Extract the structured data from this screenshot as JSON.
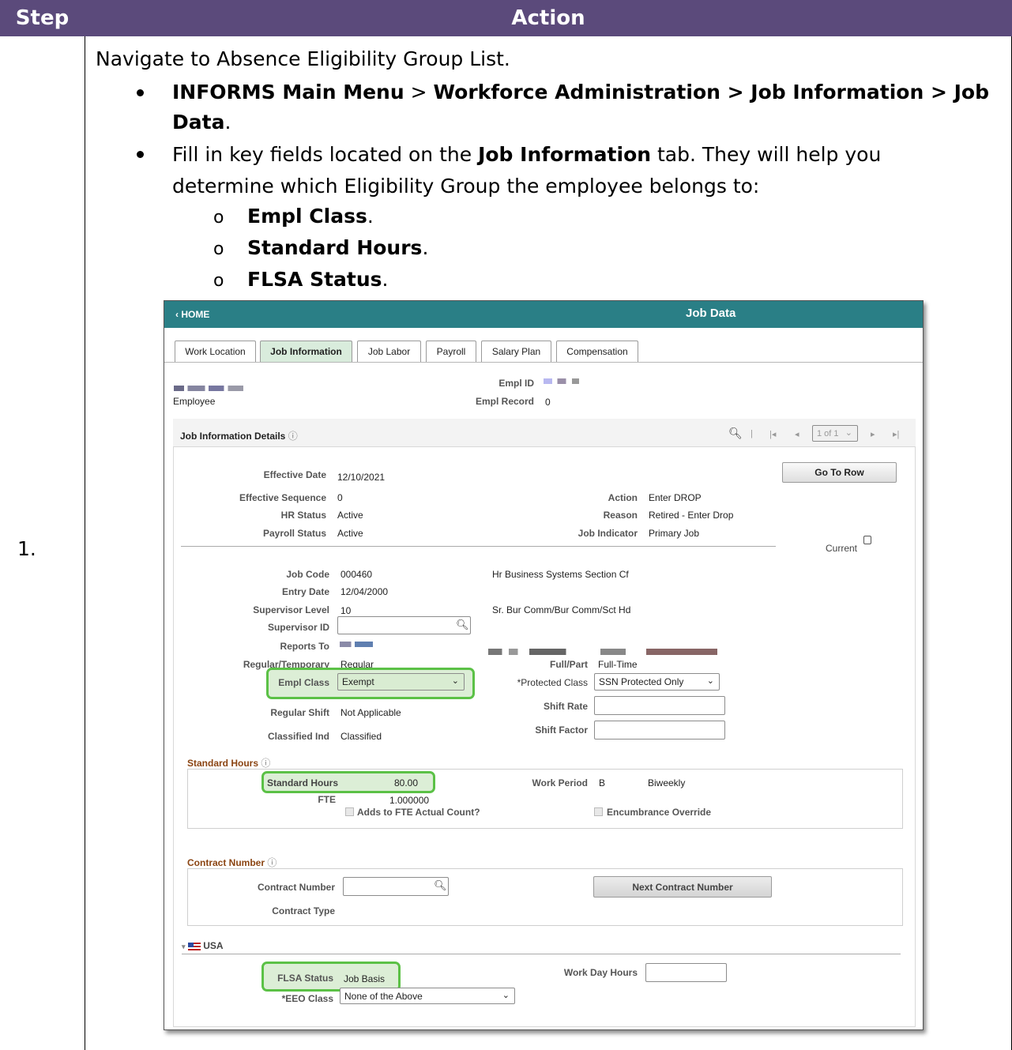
{
  "doc": {
    "header": {
      "step": "Step",
      "action": "Action"
    },
    "step_number": "1.",
    "intro": "Navigate to Absence Eligibility Group List.",
    "bullet1": {
      "nav_1": "INFORMS Main Menu",
      "sep_1": " > ",
      "nav_2": "Workforce Administration > Job Information > Job",
      "nav_3": "Data",
      "end": "."
    },
    "bullet2": {
      "pre": "Fill in key fields located on the ",
      "bold": "Job Information",
      "post": " tab. They will help you",
      "line2": "determine which Eligibility Group the employee belongs to:"
    },
    "subbullets": [
      {
        "marker": "o",
        "text": "Empl Class",
        "end": "."
      },
      {
        "marker": "o",
        "text": "Standard Hours",
        "end": "."
      },
      {
        "marker": "o",
        "text": "FLSA Status",
        "end": "."
      }
    ]
  },
  "screen": {
    "home": "HOME",
    "title": "Job Data",
    "tabs": [
      "Work Location",
      "Job Information",
      "Job Labor",
      "Payroll",
      "Salary Plan",
      "Compensation"
    ],
    "active_tab": "Job Information",
    "employee_label": "Employee",
    "empl_id_label": "Empl ID",
    "empl_record_label": "Empl Record",
    "empl_record": "0",
    "details_title": "Job Information Details",
    "pager": "1 of 1",
    "go_to_row": "Go To Row",
    "fields": {
      "effective_date_label": "Effective Date",
      "effective_date": "12/10/2021",
      "effective_seq_label": "Effective Sequence",
      "effective_seq": "0",
      "hr_status_label": "HR Status",
      "hr_status": "Active",
      "payroll_status_label": "Payroll Status",
      "payroll_status": "Active",
      "action_label": "Action",
      "action": "Enter DROP",
      "reason_label": "Reason",
      "reason": "Retired - Enter Drop",
      "job_indicator_label": "Job Indicator",
      "job_indicator": "Primary Job",
      "current_label": "Current",
      "job_code_label": "Job Code",
      "job_code": "000460",
      "job_code_desc": "Hr Business Systems Section Cf",
      "entry_date_label": "Entry Date",
      "entry_date": "12/04/2000",
      "supervisor_level_label": "Supervisor Level",
      "supervisor_level": "10",
      "supervisor_level_desc": "Sr. Bur Comm/Bur Comm/Sct Hd",
      "supervisor_id_label": "Supervisor ID",
      "reports_to_label": "Reports To",
      "regular_temp_label": "Regular/Temporary",
      "regular_temp": "Regular",
      "full_part_label": "Full/Part",
      "full_part": "Full-Time",
      "empl_class_label": "Empl Class",
      "empl_class": "Exempt",
      "protected_class_label": "*Protected Class",
      "protected_class": "SSN Protected Only",
      "shift_rate_label": "Shift Rate",
      "shift_factor_label": "Shift Factor",
      "regular_shift_label": "Regular Shift",
      "regular_shift": "Not Applicable",
      "classified_ind_label": "Classified Ind",
      "classified_ind": "Classified"
    },
    "standard_hours": {
      "section": "Standard Hours",
      "label": "Standard Hours",
      "value": "80.00",
      "fte_label": "FTE",
      "fte": "1.000000",
      "adds_fte": "Adds to FTE Actual Count?",
      "work_period_label": "Work Period",
      "work_period": "B",
      "work_period_desc": "Biweekly",
      "encumbrance": "Encumbrance Override"
    },
    "contract": {
      "section": "Contract Number",
      "number_label": "Contract Number",
      "type_label": "Contract Type",
      "next_button": "Next Contract Number"
    },
    "usa": {
      "section": "USA",
      "flsa_label": "FLSA Status",
      "flsa": "Job Basis",
      "eeo_label": "*EEO Class",
      "eeo": "None of the Above",
      "work_day_hours_label": "Work Day Hours"
    },
    "colors": {
      "header": "#5b4a7b",
      "ps_bar": "#2a7f86",
      "highlight": "#5bc146",
      "section": "#8b4513"
    }
  }
}
